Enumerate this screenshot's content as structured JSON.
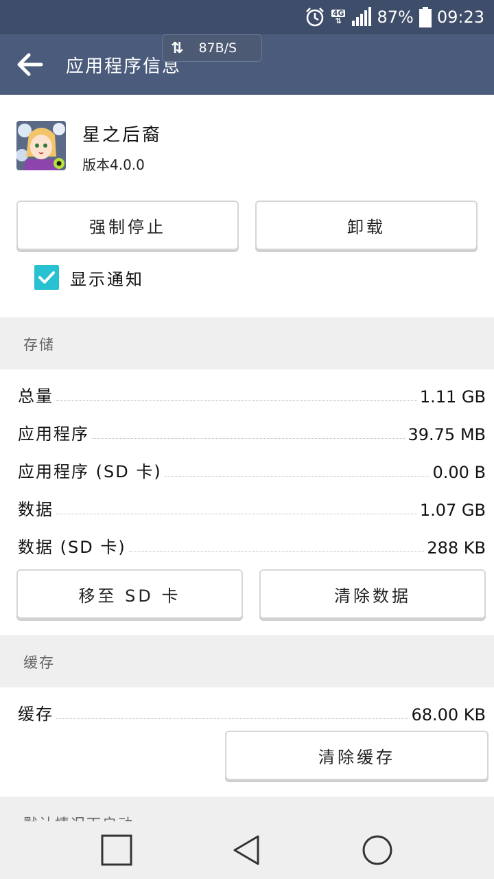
{
  "status_bar": {
    "network": "4G",
    "battery": "87%",
    "time": "09:23",
    "icons": [
      "alarm-icon",
      "data-transfer-icon",
      "signal-icon",
      "battery-icon"
    ]
  },
  "speed_toast": {
    "speed": "87B/S"
  },
  "app_bar": {
    "title": "应用程序信息"
  },
  "app": {
    "name": "星之后裔",
    "version": "版本4.0.0",
    "force_stop_label": "强制停止",
    "uninstall_label": "卸载",
    "show_notifications_label": "显示通知",
    "show_notifications_checked": true
  },
  "storage": {
    "header": "存储",
    "rows": [
      {
        "label": "总量",
        "value": "1.11 GB"
      },
      {
        "label": "应用程序",
        "value": "39.75 MB"
      },
      {
        "label": "应用程序 (SD 卡)",
        "value": "0.00 B"
      },
      {
        "label": "数据",
        "value": "1.07 GB"
      },
      {
        "label": "数据 (SD 卡)",
        "value": "288 KB"
      }
    ],
    "move_to_sd_label": "移至 SD 卡",
    "clear_data_label": "清除数据"
  },
  "cache": {
    "header": "缓存",
    "rows": [
      {
        "label": "缓存",
        "value": "68.00 KB"
      }
    ],
    "clear_cache_label": "清除缓存"
  },
  "next_section": {
    "header": "默认情况下启动"
  },
  "colors": {
    "status_bar": "#3e4d6a",
    "app_bar": "#4a5b7b",
    "checkbox": "#27c1d1",
    "section_bg": "#efefef"
  }
}
